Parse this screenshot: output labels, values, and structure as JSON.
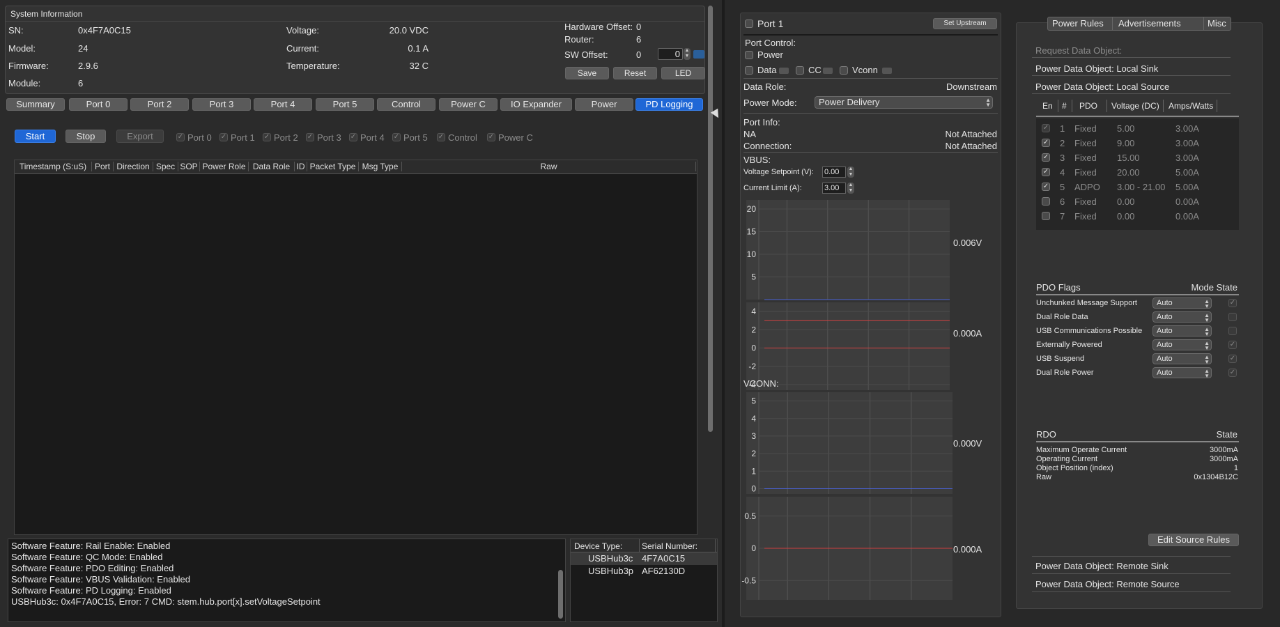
{
  "system_info": {
    "title": "System Information",
    "sn_label": "SN:",
    "sn": "0x4F7A0C15",
    "model_label": "Model:",
    "model": "24",
    "firmware_label": "Firmware:",
    "firmware": "2.9.6",
    "module_label": "Module:",
    "module": "6",
    "voltage_label": "Voltage:",
    "voltage": "20.0 VDC",
    "current_label": "Current:",
    "current": "0.1 A",
    "temperature_label": "Temperature:",
    "temperature": "32 C",
    "hw_offset_label": "Hardware Offset:",
    "hw_offset": "0",
    "router_label": "Router:",
    "router": "6",
    "sw_offset_label": "SW Offset:",
    "sw_offset": "0",
    "sw_offset_input": "0",
    "save": "Save",
    "reset": "Reset",
    "led": "LED"
  },
  "tabs": [
    "Summary",
    "Port 0",
    "Port 2",
    "Port 3",
    "Port 4",
    "Port 5",
    "Control",
    "Power C",
    "IO Expander",
    "Power",
    "PD Logging"
  ],
  "active_tab": "PD Logging",
  "logging": {
    "start": "Start",
    "stop": "Stop",
    "export": "Export",
    "filters": [
      "Port 0",
      "Port 1",
      "Port 2",
      "Port 3",
      "Port 4",
      "Port 5",
      "Control",
      "Power C"
    ],
    "columns": [
      "Timestamp (S:uS)",
      "Port",
      "Direction",
      "Spec",
      "SOP",
      "Power Role",
      "Data Role",
      "ID",
      "Packet Type",
      "Msg Type",
      "Raw"
    ]
  },
  "console": [
    "Software Feature: Rail Enable: Enabled",
    "Software Feature: QC Mode: Enabled",
    "Software Feature: PDO Editing: Enabled",
    "Software Feature: VBUS Validation: Enabled",
    "Software Feature: PD Logging: Enabled",
    "USBHub3c: 0x4F7A0C15, Error: 7 CMD: stem.hub.port[x].setVoltageSetpoint"
  ],
  "devices": {
    "col_type": "Device Type:",
    "col_serial": "Serial Number:",
    "rows": [
      {
        "type": "USBHub3c",
        "serial": "4F7A0C15"
      },
      {
        "type": "USBHub3p",
        "serial": "AF62130D"
      }
    ]
  },
  "port": {
    "title": "Port 1",
    "set_upstream": "Set Upstream",
    "control_label": "Port Control:",
    "power": "Power",
    "data": "Data",
    "cc": "CC",
    "vconn": "Vconn",
    "data_role_label": "Data Role:",
    "data_role": "Downstream",
    "power_mode_label": "Power Mode:",
    "power_mode": "Power Delivery",
    "port_info_label": "Port Info:",
    "na": "NA",
    "na_value": "Not Attached",
    "connection_label": "Connection:",
    "connection_value": "Not Attached",
    "vbus_label": "VBUS:",
    "voltage_setpoint_label": "Voltage Setpoint (V):",
    "voltage_setpoint": "0.00",
    "current_limit_label": "Current Limit (A):",
    "current_limit": "3.00",
    "vconn_label": "VCONN:",
    "readout_vbus_v": "0.006V",
    "readout_vbus_a": "0.000A",
    "readout_vconn_v": "0.000V",
    "readout_vconn_a": "0.000A"
  },
  "chart_data": [
    {
      "type": "line",
      "ylim": [
        0,
        22
      ],
      "yticks": [
        5,
        10,
        15,
        20
      ],
      "series": [
        {
          "values": [
            0.006,
            0.006
          ]
        }
      ],
      "color": "#4a63d8"
    },
    {
      "type": "line",
      "ylim": [
        -4.6,
        5
      ],
      "yticks": [
        -4,
        -2,
        0,
        2,
        4
      ],
      "series": [
        {
          "values": [
            0,
            0
          ]
        },
        {
          "values": [
            3,
            3
          ]
        }
      ],
      "color": "#d04040"
    },
    {
      "type": "line",
      "ylim": [
        -0.3,
        5.5
      ],
      "yticks": [
        0,
        1,
        2,
        3,
        4,
        5
      ],
      "series": [
        {
          "values": [
            0,
            0
          ]
        }
      ],
      "color": "#4a63d8"
    },
    {
      "type": "line",
      "ylim": [
        -0.8,
        0.8
      ],
      "yticks": [
        -0.5,
        0,
        0.5
      ],
      "series": [
        {
          "values": [
            0,
            0
          ]
        }
      ],
      "color": "#d04040"
    }
  ],
  "rules": {
    "tabs": [
      "Power Rules",
      "Advertisements",
      "Misc"
    ],
    "request_data_object": "Request Data Object:",
    "local_sink": "Power Data Object: Local Sink",
    "local_source": "Power Data Object: Local Source",
    "pdo_columns": [
      "En",
      "#",
      "PDO",
      "Voltage (DC)",
      "Amps/Watts"
    ],
    "pdos": [
      {
        "checked": true,
        "num": "1",
        "pdo": "Fixed",
        "voltage": "5.00",
        "amps": "3.00A",
        "disabled": true
      },
      {
        "checked": true,
        "num": "2",
        "pdo": "Fixed",
        "voltage": "9.00",
        "amps": "3.00A"
      },
      {
        "checked": true,
        "num": "3",
        "pdo": "Fixed",
        "voltage": "15.00",
        "amps": "3.00A"
      },
      {
        "checked": true,
        "num": "4",
        "pdo": "Fixed",
        "voltage": "20.00",
        "amps": "5.00A"
      },
      {
        "checked": true,
        "num": "5",
        "pdo": "ADPO",
        "voltage": "3.00 - 21.00",
        "amps": "5.00A"
      },
      {
        "checked": false,
        "num": "6",
        "pdo": "Fixed",
        "voltage": "0.00",
        "amps": "0.00A"
      },
      {
        "checked": false,
        "num": "7",
        "pdo": "Fixed",
        "voltage": "0.00",
        "amps": "0.00A"
      }
    ],
    "flags_title": "PDO Flags",
    "mode_state": "Mode State",
    "flags": [
      {
        "name": "Unchunked Message Support",
        "mode": "Auto",
        "state": true
      },
      {
        "name": "Dual Role Data",
        "mode": "Auto",
        "state": false
      },
      {
        "name": "USB Communications Possible",
        "mode": "Auto",
        "state": false
      },
      {
        "name": "Externally Powered",
        "mode": "Auto",
        "state": true
      },
      {
        "name": "USB Suspend",
        "mode": "Auto",
        "state": true
      },
      {
        "name": "Dual Role Power",
        "mode": "Auto",
        "state": true
      }
    ],
    "rdo_title": "RDO",
    "rdo_state": "State",
    "rdo": [
      {
        "name": "Maximum Operate Current",
        "value": "3000mA"
      },
      {
        "name": "Operating Current",
        "value": "3000mA"
      },
      {
        "name": "Object Position (index)",
        "value": "1"
      },
      {
        "name": "Raw",
        "value": "0x1304B12C"
      }
    ],
    "edit_source_rules": "Edit Source Rules",
    "remote_sink": "Power Data Object: Remote Sink",
    "remote_source": "Power Data Object: Remote Source"
  }
}
